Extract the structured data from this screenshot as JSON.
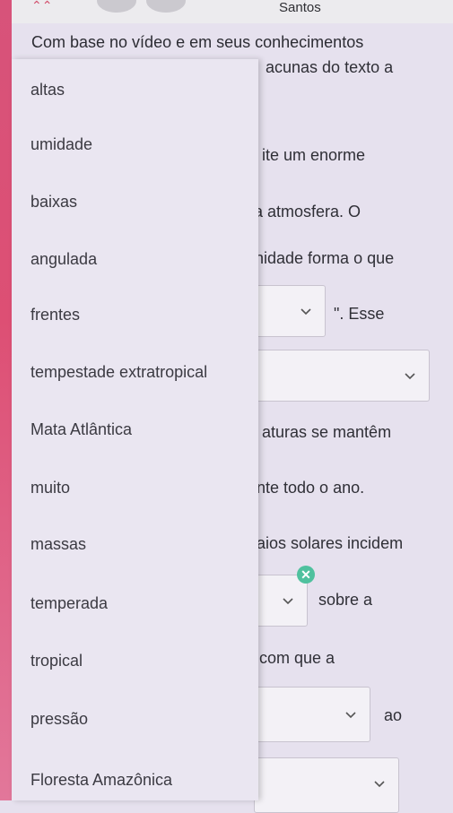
{
  "header": {
    "name": "Santos"
  },
  "prompt": "Com base no vídeo e em seus conhecimentos",
  "passage_fragments": [
    "acunas do texto a",
    "ite um enorme",
    "a atmosfera. O",
    "nidade forma o que",
    "\". Esse",
    "aturas se mantêm",
    "nte todo o ano.",
    "aios solares incidem",
    "sobre a",
    "com que a",
    "ao"
  ],
  "options": [
    "altas",
    "umidade",
    "baixas",
    "angulada",
    "frentes",
    "tempestade extratropical",
    "Mata Atlântica",
    "muito",
    "massas",
    "temperada",
    "tropical",
    "pressão",
    "Floresta Amazônica"
  ],
  "icons": {
    "close": "close-icon",
    "chevron": "chevron-down-icon"
  },
  "colors": {
    "accent_pink": "#dd4f74",
    "close_green": "#4fc19e",
    "panel": "#eae6f1"
  }
}
